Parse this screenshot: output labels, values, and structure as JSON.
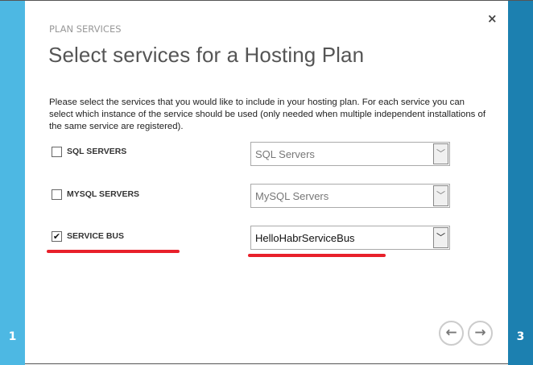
{
  "dialog": {
    "eyebrow": "PLAN SERVICES",
    "title": "Select services for a Hosting Plan",
    "close_icon": "×",
    "description": "Please select the services that you would like to include in your hosting plan. For each service you can select which instance of the service should be used (only needed when multiple independent installations of the same service are registered)."
  },
  "services": [
    {
      "label": "SQL SERVERS",
      "checked": false,
      "selected": "SQL Servers"
    },
    {
      "label": "MYSQL SERVERS",
      "checked": false,
      "selected": "MySQL Servers"
    },
    {
      "label": "SERVICE BUS",
      "checked": true,
      "selected": "HelloHabrServiceBus",
      "check": "✔"
    }
  ],
  "steps": {
    "current": "1",
    "next": "3"
  },
  "nav": {
    "back": "←",
    "forward": "→"
  },
  "colors": {
    "left_bar": "#4db8e3",
    "right_bar": "#1c80b0",
    "highlight": "#e8202a"
  }
}
